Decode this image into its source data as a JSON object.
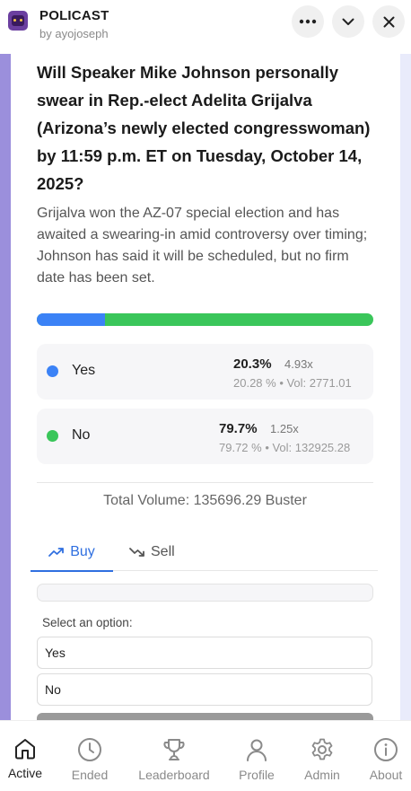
{
  "app": {
    "title": "POLICAST",
    "author": "by ayojoseph"
  },
  "market": {
    "question": "Will Speaker Mike Johnson personally swear in Rep.-elect Adelita Grijalva (Arizona’s newly elected congresswoman) by 11:59 p.m. ET on Tuesday, October 14, 2025?",
    "description": "Grijalva won the AZ-07 special election and has awaited a swearing-in amid controversy over timing; Johnson has said it will be scheduled, but no firm date has been set.",
    "yes_share": 0.203,
    "colors": {
      "yes": "#3b82f6",
      "no": "#3ac65a"
    }
  },
  "options": [
    {
      "label": "Yes",
      "pct": "20.3%",
      "mult": "4.93x",
      "sub": "20.28 % • Vol: 2771.01"
    },
    {
      "label": "No",
      "pct": "79.7%",
      "mult": "1.25x",
      "sub": "79.72 % • Vol: 132925.28"
    }
  ],
  "total_volume": "Total Volume: 135696.29 Buster",
  "trade": {
    "tabs": [
      "Buy",
      "Sell"
    ],
    "active_tab": "Buy",
    "select_label": "Select an option:",
    "select_options": [
      "Yes",
      "No"
    ]
  },
  "nav": [
    {
      "label": "Active",
      "icon": "home-icon"
    },
    {
      "label": "Ended",
      "icon": "clock-icon"
    },
    {
      "label": "Leaderboard",
      "icon": "trophy-icon"
    },
    {
      "label": "Profile",
      "icon": "user-icon"
    },
    {
      "label": "Admin",
      "icon": "gear-icon"
    },
    {
      "label": "About",
      "icon": "info-icon"
    }
  ]
}
